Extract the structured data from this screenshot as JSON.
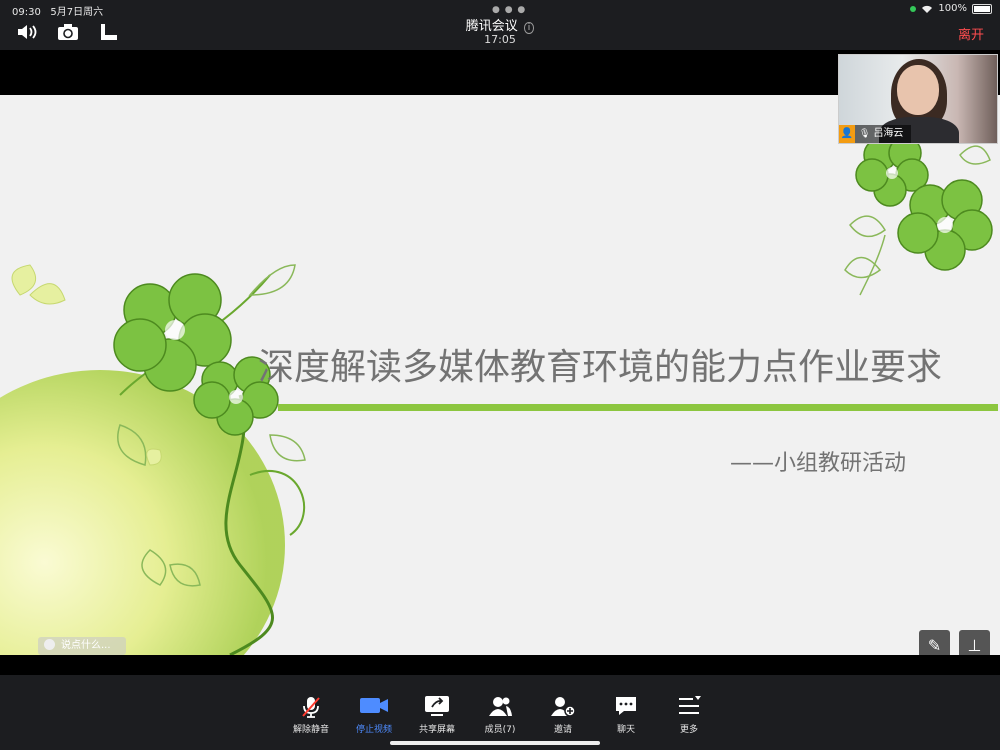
{
  "status": {
    "time": "09:30",
    "date": "5月7日周六",
    "battery": "100%"
  },
  "header": {
    "title": "腾讯会议",
    "clock": "17:05",
    "leave_label": "离开"
  },
  "slide": {
    "title": "深度解读多媒体教育环境的能力点作业要求",
    "subtitle": "——小组教研活动",
    "comment_placeholder": "说点什么...",
    "accent_color": "#8cc63f"
  },
  "video": {
    "name": "吕海云"
  },
  "toolbar": {
    "items": [
      {
        "label": "解除静音",
        "icon": "mic-muted-icon"
      },
      {
        "label": "停止视频",
        "icon": "video-camera-icon"
      },
      {
        "label": "共享屏幕",
        "icon": "screen-share-icon"
      },
      {
        "label": "成员(7)",
        "icon": "members-icon"
      },
      {
        "label": "邀请",
        "icon": "invite-icon"
      },
      {
        "label": "聊天",
        "icon": "chat-icon"
      },
      {
        "label": "更多",
        "icon": "more-menu-icon"
      }
    ]
  }
}
